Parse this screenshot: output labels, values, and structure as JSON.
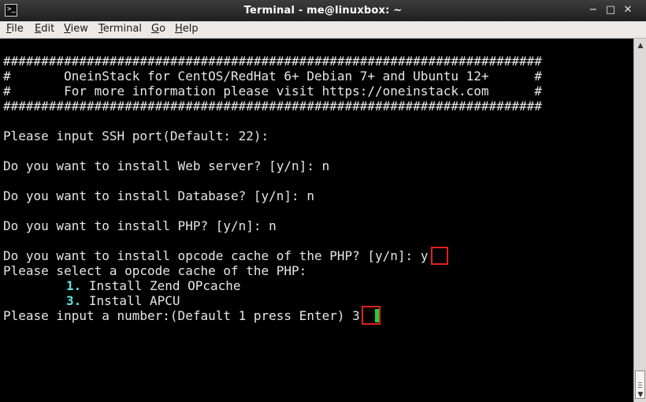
{
  "window": {
    "title": "Terminal - me@linuxbox: ~",
    "icon_glyph": ">_",
    "controls": {
      "minimize": "−",
      "maximize": "□",
      "close": "✕",
      "restore": "~"
    }
  },
  "menu": {
    "items": [
      {
        "u": "F",
        "rest": "ile"
      },
      {
        "u": "E",
        "rest": "dit"
      },
      {
        "u": "V",
        "rest": "iew"
      },
      {
        "u": "T",
        "rest": "erminal"
      },
      {
        "u": "G",
        "rest": "o"
      },
      {
        "u": "H",
        "rest": "elp"
      }
    ]
  },
  "terminal": {
    "banner_border": "#######################################################################",
    "banner_line1": "#       OneinStack for CentOS/RedHat 6+ Debian 7+ and Ubuntu 12+      #",
    "banner_line2": "#       For more information please visit https://oneinstack.com      #",
    "ssh_prompt": "Please input SSH port(Default: 22):",
    "web_prompt": "Do you want to install Web server? [y/n]: n",
    "db_prompt": "Do you want to install Database? [y/n]: n",
    "php_prompt": "Do you want to install PHP? [y/n]: n",
    "opcode_prompt": "Do you want to install opcode cache of the PHP? [y/n]: ",
    "opcode_answer": "y",
    "select_prompt": "Please select a opcode cache of the PHP:",
    "option1_num": "1.",
    "option1_label": " Install Zend OPcache",
    "option3_num": "3.",
    "option3_label": " Install APCU",
    "number_prompt": "Please input a number:(Default 1 press Enter) ",
    "number_answer": "3"
  },
  "colors": {
    "highlight": "#e0211b",
    "cursor": "#19d23e",
    "option_number": "#5ee6e6"
  },
  "scrollbar": {
    "up_icon": "▲",
    "down_icon": "▼"
  }
}
